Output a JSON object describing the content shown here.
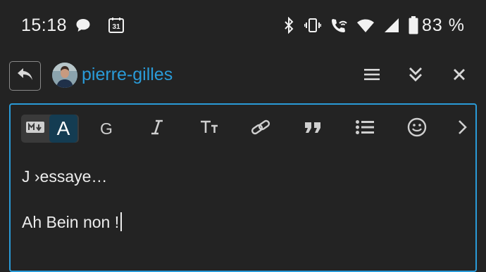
{
  "status_bar": {
    "time": "15:18",
    "calendar_day": "31",
    "battery_percent": "83 %",
    "icons": [
      "chat-bubble-icon",
      "calendar-icon",
      "bluetooth-icon",
      "vibrate-icon",
      "wifi-call-icon",
      "wifi-icon",
      "cell-signal-icon",
      "battery-icon"
    ]
  },
  "header": {
    "username": "pierre-gilles",
    "icons": [
      "reply-icon",
      "menu-icon",
      "collapse-icon",
      "close-icon"
    ]
  },
  "toolbar": {
    "mode_md_icon": "markdown-icon",
    "mode_wysiwyg_label": "A",
    "bold_label": "G",
    "icons": [
      "italic-icon",
      "heading-icon",
      "link-icon",
      "quote-icon",
      "bullet-list-icon",
      "emoji-icon",
      "chevron-right-icon"
    ]
  },
  "editor": {
    "line1": "J ›essaye…",
    "line2": "Ah Bein non !"
  },
  "colors": {
    "background": "#232323",
    "accent": "#2a9bd8",
    "toggle_active": "#143c52"
  }
}
